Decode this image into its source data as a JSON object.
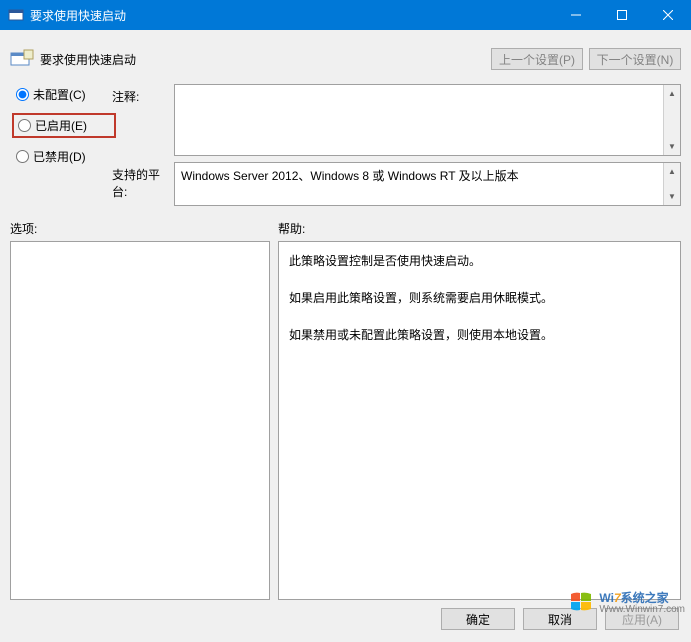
{
  "window": {
    "title": "要求使用快速启动"
  },
  "header": {
    "title": "要求使用快速启动",
    "prev": "上一个设置(P)",
    "next": "下一个设置(N)"
  },
  "radios": {
    "not_configured": "未配置(C)",
    "enabled": "已启用(E)",
    "disabled": "已禁用(D)",
    "selected": "not_configured"
  },
  "labels": {
    "comment": "注释:",
    "platform": "支持的平台:",
    "options": "选项:",
    "help": "帮助:"
  },
  "platform_text": "Windows Server 2012、Windows 8 或 Windows RT 及以上版本",
  "help": {
    "p1": "此策略设置控制是否使用快速启动。",
    "p2": "如果启用此策略设置，则系统需要启用休眠模式。",
    "p3": "如果禁用或未配置此策略设置，则使用本地设置。"
  },
  "footer": {
    "ok": "确定",
    "cancel": "取消",
    "apply": "应用(A)"
  },
  "watermark": {
    "brand_prefix": "Wi",
    "brand_seven": "7",
    "brand_suffix": "系统之家",
    "url": "Www.Winwin7.com"
  }
}
